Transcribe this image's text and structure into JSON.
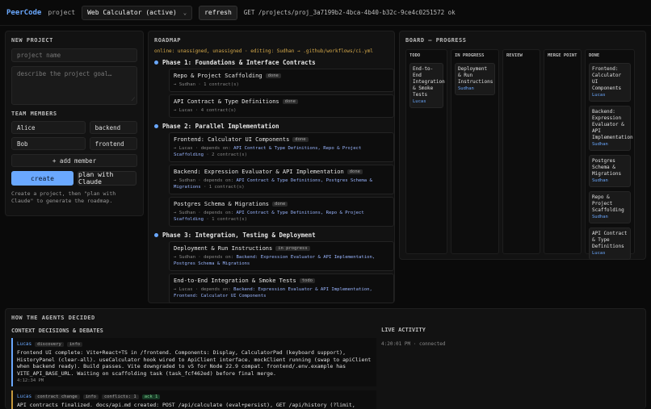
{
  "topbar": {
    "brand": "PeerCode",
    "project_label": "project",
    "project_value": "Web Calculator (active)",
    "refresh_label": "refresh",
    "status": "GET /projects/proj_3a7199b2-4bca-4b40-b32c-9ce4c0251572 ok"
  },
  "new_project": {
    "title": "NEW PROJECT",
    "name_placeholder": "project name",
    "goal_placeholder": "describe the project goal…",
    "team_title": "TEAM MEMBERS",
    "members": [
      {
        "name": "Alice",
        "role": "backend"
      },
      {
        "name": "Bob",
        "role": "frontend"
      }
    ],
    "add_member_label": "+ add member",
    "create_label": "create",
    "plan_label": "plan with Claude",
    "hint": "Create a project, then \"plan with Claude\" to generate the roadmap."
  },
  "roadmap": {
    "title": "ROADMAP",
    "meta": "online: unassigned, unassigned · editing: Sudhan → .github/workflows/ci.yml",
    "phases": [
      {
        "label": "Phase 1: Foundations & Interface Contracts",
        "tasks": [
          {
            "title": "Repo & Project Scaffolding",
            "status": "done",
            "owner": "→ Sudhan",
            "deps_label": "",
            "deps": "",
            "contracts": "· 1 contract(s)"
          },
          {
            "title": "API Contract & Type Definitions",
            "status": "done",
            "owner": "→ Lucas",
            "deps_label": "",
            "deps": "",
            "contracts": "· 4 contract(s)"
          }
        ]
      },
      {
        "label": "Phase 2: Parallel Implementation",
        "tasks": [
          {
            "title": "Frontend: Calculator UI Components",
            "status": "done",
            "owner": "→ Lucas ·",
            "deps_label": "depends on:",
            "deps": "API Contract & Type Definitions, Repo & Project Scaffolding",
            "contracts": "· 2 contract(s)"
          },
          {
            "title": "Backend: Expression Evaluator & API Implementation",
            "status": "done",
            "owner": "→ Sudhan ·",
            "deps_label": "depends on:",
            "deps": "API Contract & Type Definitions, Postgres Schema & Migrations",
            "contracts": "· 1 contract(s)"
          },
          {
            "title": "Postgres Schema & Migrations",
            "status": "done",
            "owner": "→ Sudhan ·",
            "deps_label": "depends on:",
            "deps": "API Contract & Type Definitions, Repo & Project Scaffolding",
            "contracts": "· 1 contract(s)"
          }
        ]
      },
      {
        "label": "Phase 3: Integration, Testing & Deployment",
        "tasks": [
          {
            "title": "Deployment & Run Instructions",
            "status": "in progress",
            "owner": "→ Sudhan ·",
            "deps_label": "depends on:",
            "deps": "Backend: Expression Evaluator & API Implementation, Postgres Schema & Migrations",
            "contracts": ""
          },
          {
            "title": "End-to-End Integration & Smoke Tests",
            "status": "todo",
            "owner": "→ Lucas ·",
            "deps_label": "depends on:",
            "deps": "Backend: Expression Evaluator & API Implementation, Frontend: Calculator UI Components",
            "contracts": ""
          }
        ]
      }
    ]
  },
  "board": {
    "title": "BOARD — PROGRESS",
    "columns": [
      {
        "title": "TODO",
        "cards": [
          {
            "title": "End-to-End Integration & Smoke Tests",
            "owner": "Lucas"
          }
        ]
      },
      {
        "title": "IN PROGRESS",
        "cards": [
          {
            "title": "Deployment & Run Instructions",
            "owner": "Sudhan"
          }
        ]
      },
      {
        "title": "REVIEW",
        "cards": []
      },
      {
        "title": "MERGE POINT",
        "cards": []
      },
      {
        "title": "DONE",
        "cards": [
          {
            "title": "Frontend: Calculator UI Components",
            "owner": "Lucas"
          },
          {
            "title": "Backend: Expression Evaluator & API Implementation",
            "owner": "Sudhan"
          },
          {
            "title": "Postgres Schema & Migrations",
            "owner": "Sudhan"
          },
          {
            "title": "Repo & Project Scaffolding",
            "owner": "Sudhan"
          },
          {
            "title": "API Contract & Type Definitions",
            "owner": "Lucas"
          }
        ]
      }
    ]
  },
  "decisions": {
    "title": "HOW THE AGENTS DECIDED",
    "context_title": "CONTEXT DECISIONS & DEBATES",
    "entries": [
      {
        "who": "Lucas",
        "tags": [
          "discovery",
          "info"
        ],
        "body": "Frontend UI complete: Vite+React+TS in /frontend. Components: Display, CalculatorPad (keyboard support), HistoryPanel (clear-all). useCalculator hook wired to ApiClient interface. mockClient running (swap to apiClient when backend ready). Build passes. Vite downgraded to v5 for Node 22.9 compat. frontend/.env.example has VITE_API_BASE_URL. Waiting on scaffolding task (task_fcf462ed) before final merge.",
        "time": "4:12:34 PM"
      },
      {
        "who": "Lucas",
        "tags": [
          "contract change",
          "info",
          "conflicts: 1",
          "ack 1"
        ],
        "body": "API contracts finalized. docs/api.md created: POST /api/calculate (eval+persist), GET /api/history (?limit,",
        "time": ""
      }
    ],
    "live_title": "LIVE ACTIVITY",
    "live_line": "4:20:01 PM · connected"
  }
}
